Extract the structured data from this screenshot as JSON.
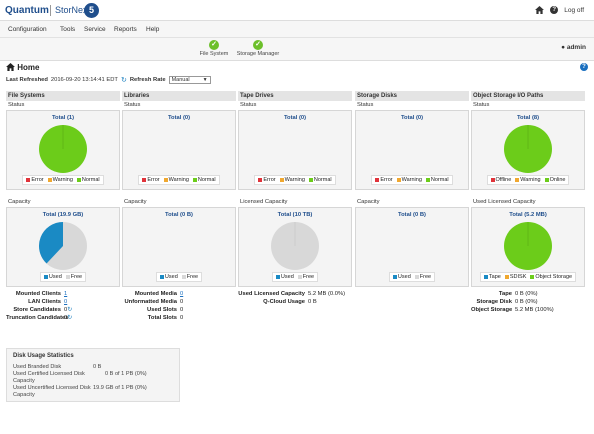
{
  "header": {
    "brand": "Quantum",
    "product": "StorNext",
    "badge": "5",
    "logout": "Log off"
  },
  "menu": [
    "Configuration",
    "Tools",
    "Service",
    "Reports",
    "Help"
  ],
  "status": {
    "items": [
      "File System",
      "Storage Manager"
    ],
    "user": "admin"
  },
  "page": {
    "title": "Home",
    "last_refreshed_label": "Last Refreshed",
    "last_refreshed_value": "2016-09-20 13:14:41 EDT",
    "refresh_rate_label": "Refresh Rate",
    "refresh_rate_value": "Manual"
  },
  "colors": {
    "green": "#6ccc1a",
    "blue": "#1a8ac4",
    "gray": "#d8d8d8",
    "error": "#e0333a",
    "warning": "#f0a830"
  },
  "columns": [
    {
      "title": "File Systems",
      "status_label": "Status",
      "status_total": "Total (1)",
      "status_legend": [
        "Error",
        "Warning",
        "Normal"
      ],
      "cap_label": "Capacity",
      "cap_total": "Total (19.9 GB)",
      "cap_legend": [
        "Used",
        "Free"
      ],
      "stats": [
        {
          "k": "Mounted Clients",
          "v": "1",
          "link": true
        },
        {
          "k": "LAN Clients",
          "v": "0",
          "link": true
        },
        {
          "k": "Store Candidates",
          "v": "0",
          "refresh": true
        },
        {
          "k": "Truncation Candidates",
          "v": "0",
          "refresh": true
        }
      ]
    },
    {
      "title": "Libraries",
      "status_label": "Status",
      "status_total": "Total (0)",
      "status_legend": [
        "Error",
        "Warning",
        "Normal"
      ],
      "cap_label": "Capacity",
      "cap_total": "Total (0 B)",
      "cap_legend": [
        "Used",
        "Free"
      ],
      "stats": [
        {
          "k": "Mounted Media",
          "v": "0",
          "link": true
        },
        {
          "k": "Unformatted Media",
          "v": "0"
        },
        {
          "k": "Used Slots",
          "v": "0"
        },
        {
          "k": "Total Slots",
          "v": "0"
        }
      ]
    },
    {
      "title": "Tape Drives",
      "status_label": "Status",
      "status_total": "Total (0)",
      "status_legend": [
        "Error",
        "Warning",
        "Normal"
      ],
      "cap_label": "Licensed Capacity",
      "cap_total": "Total (10 TB)",
      "cap_legend": [
        "Used",
        "Free"
      ],
      "stats": [
        {
          "k": "Used Licensed Capacity",
          "v": "5.2 MB (0.0%)"
        },
        {
          "k": "Q-Cloud Usage",
          "v": "0 B"
        }
      ]
    },
    {
      "title": "Storage Disks",
      "status_label": "Status",
      "status_total": "Total (0)",
      "status_legend": [
        "Error",
        "Warning",
        "Normal"
      ],
      "cap_label": "Capacity",
      "cap_total": "Total (0 B)",
      "cap_legend": [
        "Used",
        "Free"
      ],
      "stats": []
    },
    {
      "title": "Object Storage I/O Paths",
      "status_label": "Status",
      "status_total": "Total (8)",
      "status_legend": [
        "Offline",
        "Warning",
        "Online"
      ],
      "cap_label": "Used Licensed Capacity",
      "cap_total": "Total (5.2 MB)",
      "cap_legend": [
        "Tape",
        "SDISK",
        "Object Storage"
      ],
      "stats": [
        {
          "k": "Tape",
          "v": "0 B (0%)"
        },
        {
          "k": "Storage Disk",
          "v": "0 B (0%)"
        },
        {
          "k": "Object Storage",
          "v": "5.2 MB (100%)"
        }
      ]
    }
  ],
  "disk_usage": {
    "title": "Disk Usage Statistics",
    "rows": [
      {
        "k": "Used Branded Disk",
        "v": "0 B"
      },
      {
        "k": "Used Certified Licensed Disk Capacity",
        "v": "0 B of 1 PB (0%)"
      },
      {
        "k": "Used Uncertified Licensed Disk Capacity",
        "v": "19.9 GB of 1 PB (0%)"
      }
    ]
  }
}
